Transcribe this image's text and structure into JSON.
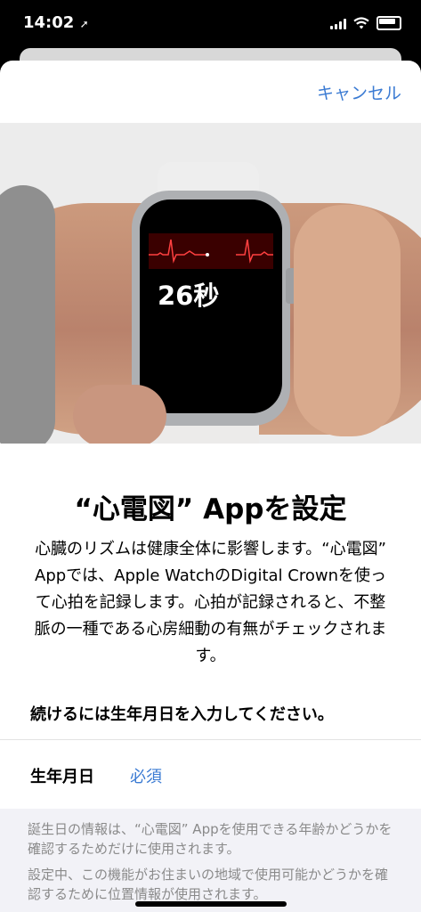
{
  "status_bar": {
    "time": "14:02",
    "location_arrow": "➚"
  },
  "header": {
    "cancel_label": "キャンセル"
  },
  "hero": {
    "watch_time": "26秒"
  },
  "main": {
    "title": "“心電図” Appを設定",
    "body": "心臓のリズムは健康全体に影響します。“心電図” Appでは、Apple WatchのDigital Crownを使って心拍を記録します。心拍が記録されると、不整脈の一種である心房細動の有無がチェックされます。",
    "prompt": "続けるには生年月日を入力してください。",
    "dob_label": "生年月日",
    "dob_value": "必須"
  },
  "footer": {
    "paragraph1": "誕生日の情報は、“心電図” Appを使用できる年齢かどうかを確認するためだけに使用されます。",
    "paragraph2": "設定中、この機能がお住まいの地域で使用可能かどうかを確認するために位置情報が使用されます。"
  },
  "colors": {
    "accent": "#3b7bd3",
    "ecg": "#ff4040"
  }
}
